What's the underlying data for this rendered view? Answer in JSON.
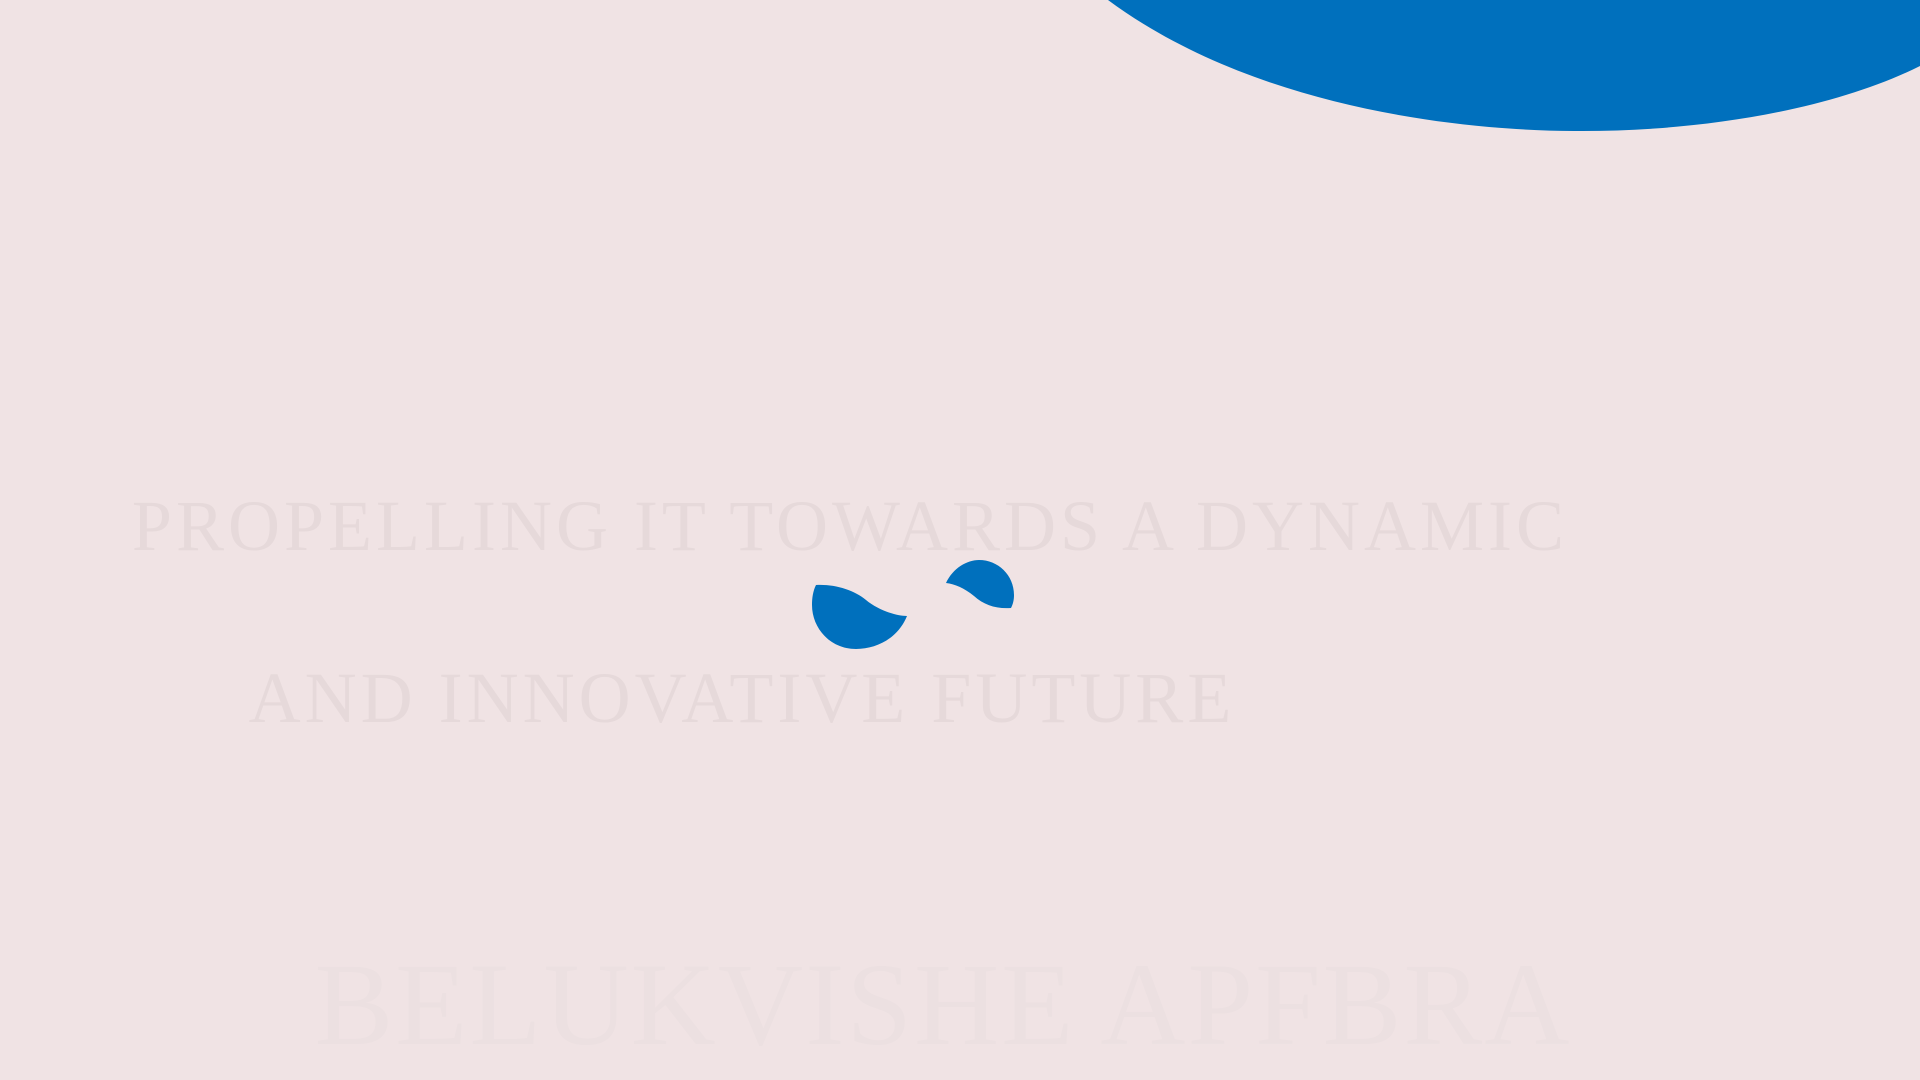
{
  "colors": {
    "background": "#f0e3e4",
    "accent_blue": "#0070bd",
    "headline_text": "#e6d9da",
    "faint_text": "#ece0e1"
  },
  "headline": {
    "line1": "PROPELLING IT TOWARDS A DYNAMIC",
    "line2": "AND INNOVATIVE FUTURE"
  },
  "bottom_text": "BELUKVISHE APFBRA",
  "icons": {
    "top_shape": "blue-curved-shape",
    "logo": "blue-infinity-logo"
  }
}
